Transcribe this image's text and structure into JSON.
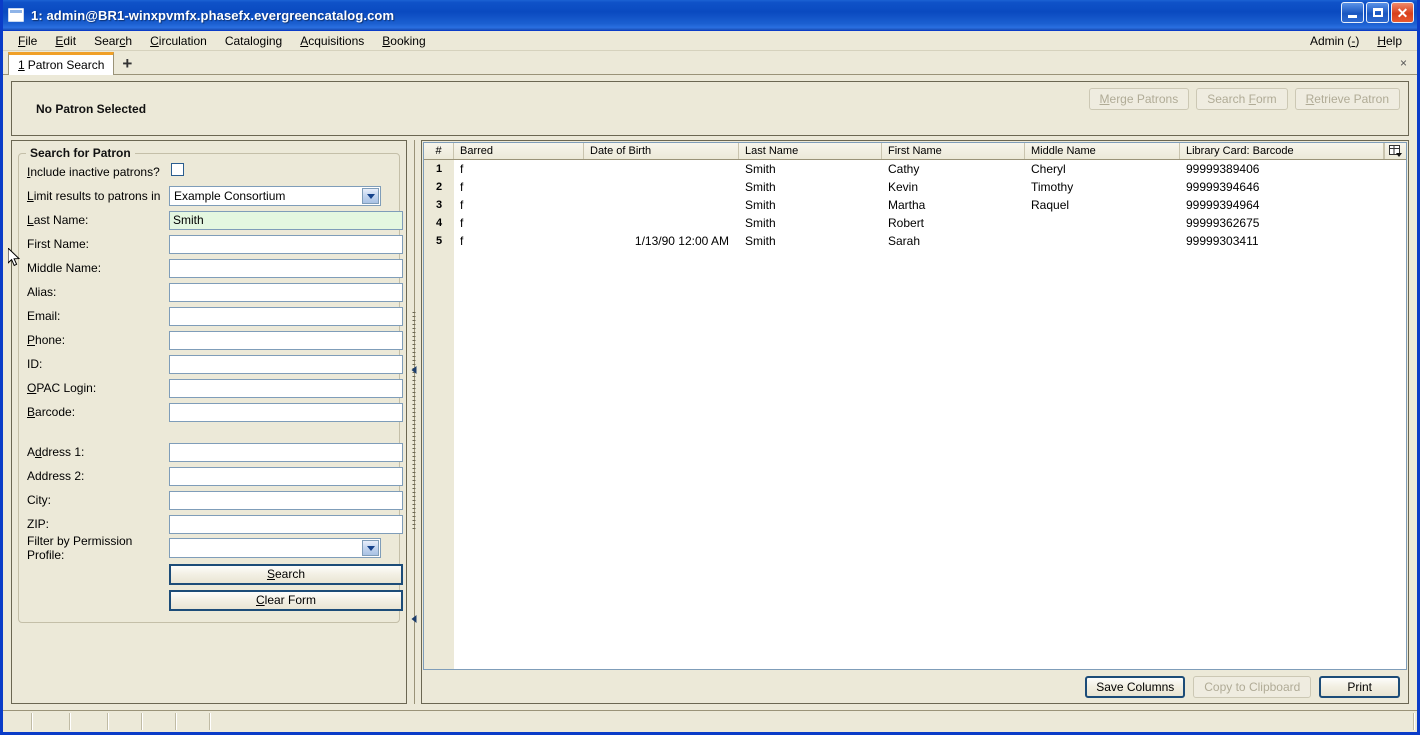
{
  "window": {
    "title": "1: admin@BR1-winxpvmfx.phasefx.evergreencatalog.com",
    "icon": "window-icon",
    "minimize_label": "",
    "maximize_label": "",
    "close_label": "✕"
  },
  "menubar": {
    "items": [
      {
        "label": "File",
        "accel": "F"
      },
      {
        "label": "Edit",
        "accel": "E"
      },
      {
        "label": "Search",
        "accel": "c"
      },
      {
        "label": "Circulation",
        "accel": "C"
      },
      {
        "label": "Cataloging",
        "accel": ""
      },
      {
        "label": "Acquisitions",
        "accel": "A"
      },
      {
        "label": "Booking",
        "accel": "B"
      }
    ],
    "right_items": [
      {
        "label": "Admin (-)",
        "accel": ""
      },
      {
        "label": "Help",
        "accel": "H"
      }
    ]
  },
  "tabs": {
    "active": {
      "index": "1",
      "label": "Patron Search"
    },
    "add_label": "+",
    "close_label": "×"
  },
  "patron_header": {
    "status": "No Patron Selected",
    "buttons": [
      {
        "label": "Merge Patrons",
        "enabled": false
      },
      {
        "label": "Search Form",
        "enabled": false
      },
      {
        "label": "Retrieve Patron",
        "enabled": false
      }
    ]
  },
  "search_form": {
    "legend": "Search for Patron",
    "fields": {
      "include_inactive_label": "Include inactive patrons?",
      "include_inactive_checked": false,
      "limit_results_label": "Limit results to patrons in",
      "limit_results_value": "Example Consortium",
      "last_name_label": "Last Name:",
      "last_name_value": "Smith",
      "first_name_label": "First Name:",
      "first_name_value": "",
      "middle_name_label": "Middle Name:",
      "middle_name_value": "",
      "alias_label": "Alias:",
      "alias_value": "",
      "email_label": "Email:",
      "email_value": "",
      "phone_label": "Phone:",
      "phone_value": "",
      "id_label": "ID:",
      "id_value": "",
      "opac_login_label": "OPAC Login:",
      "opac_login_value": "",
      "barcode_label": "Barcode:",
      "barcode_value": "",
      "address1_label": "Address 1:",
      "address1_value": "",
      "address2_label": "Address 2:",
      "address2_value": "",
      "city_label": "City:",
      "city_value": "",
      "zip_label": "ZIP:",
      "zip_value": "",
      "permission_profile_label": "Filter by Permission Profile:",
      "permission_profile_value": ""
    },
    "search_button": "Search",
    "clear_button": "Clear Form"
  },
  "results": {
    "columns": [
      "#",
      "Barred",
      "Date of Birth",
      "Last Name",
      "First Name",
      "Middle Name",
      "Library Card: Barcode"
    ],
    "column_picker_icon": "column-picker-icon",
    "rows": [
      {
        "num": "1",
        "barred": "f",
        "dob": "",
        "last": "Smith",
        "first": "Cathy",
        "middle": "Cheryl",
        "barcode": "99999389406"
      },
      {
        "num": "2",
        "barred": "f",
        "dob": "",
        "last": "Smith",
        "first": "Kevin",
        "middle": "Timothy",
        "barcode": "99999394646"
      },
      {
        "num": "3",
        "barred": "f",
        "dob": "",
        "last": "Smith",
        "first": "Martha",
        "middle": "Raquel",
        "barcode": "99999394964"
      },
      {
        "num": "4",
        "barred": "f",
        "dob": "",
        "last": "Smith",
        "first": "Robert",
        "middle": "",
        "barcode": "99999362675"
      },
      {
        "num": "5",
        "barred": "f",
        "dob": "1/13/90 12:00 AM",
        "last": "Smith",
        "first": "Sarah",
        "middle": "",
        "barcode": "99999303411"
      }
    ],
    "footer_buttons": [
      {
        "label": "Save Columns",
        "enabled": true
      },
      {
        "label": "Copy to Clipboard",
        "enabled": false
      },
      {
        "label": "Print",
        "enabled": true
      }
    ]
  },
  "statusbar": {
    "segments": [
      "",
      "",
      "",
      "",
      "",
      "",
      ""
    ]
  },
  "colors": {
    "titlebar_blue": "#0a4ac0",
    "window_border": "#0a3cc8",
    "face": "#ece9d8",
    "tab_accent": "#f0a028",
    "focused_field": "#e4f7e0",
    "field_border": "#7f9db9"
  }
}
